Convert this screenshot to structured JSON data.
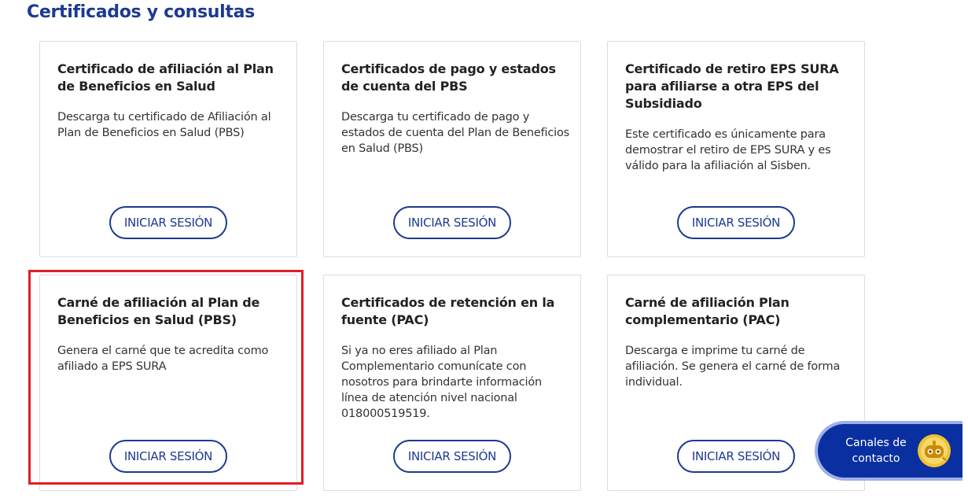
{
  "page": {
    "title": "Certificados y consultas"
  },
  "cards": [
    {
      "title": "Certificado de afiliación al Plan de Beneficios en Salud",
      "description": "Descarga tu certificado de Afiliación al Plan de Beneficios en Salud (PBS)",
      "button": "INICIAR SESIÓN"
    },
    {
      "title": "Certificados de pago y estados de cuenta del PBS",
      "description": "Descarga tu certificado de pago y estados de cuenta del Plan de Beneficios en Salud (PBS)",
      "button": "INICIAR SESIÓN"
    },
    {
      "title": "Certificado de retiro EPS SURA para afiliarse a otra EPS del Subsidiado",
      "description": "Este certificado es únicamente para demostrar el retiro de EPS SURA y es válido para la afiliación al Sisben.",
      "button": "INICIAR SESIÓN"
    },
    {
      "title": "Carné de afiliación al Plan de Beneficios en Salud (PBS)",
      "description": "Genera el carné que te acredita como afiliado a EPS SURA",
      "button": "INICIAR SESIÓN"
    },
    {
      "title": "Certificados de retención en la fuente (PAC)",
      "description": "Si ya no eres afiliado al Plan Complementario comunícate con nosotros para brindarte información línea de atención nivel nacional 018000519519.",
      "button": "INICIAR SESIÓN"
    },
    {
      "title": "Carné de afiliación Plan complementario (PAC)",
      "description": "Descarga e imprime tu carné de afiliación. Se genera el carné de forma individual.",
      "button": "INICIAR SESIÓN"
    }
  ],
  "contact_widget": {
    "label": "Canales de contacto",
    "icon": "chat-bot-icon"
  },
  "colors": {
    "brand": "#1d3a8f",
    "highlight": "#e11d26",
    "contact_bg": "#0a2fa0"
  }
}
